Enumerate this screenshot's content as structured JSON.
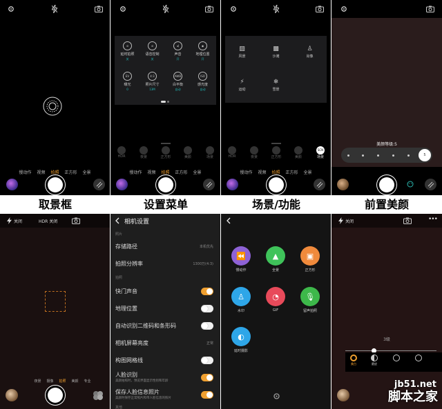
{
  "captions": [
    "取景框",
    "设置菜单",
    "场景/功能",
    "前置美颜"
  ],
  "camera_modes": [
    "慢动作",
    "视频",
    "拍照",
    "正方形",
    "全景"
  ],
  "active_mode": "拍照",
  "panel2": {
    "menu": [
      {
        "label": "延时拍照",
        "value": "关",
        "icon": "timer-off-icon"
      },
      {
        "label": "语音控制",
        "value": "关",
        "icon": "mic-off-icon"
      },
      {
        "label": "声音",
        "value": "开",
        "icon": "sound-icon"
      },
      {
        "label": "地理位置",
        "value": "开",
        "icon": "location-icon"
      },
      {
        "label": "曝光",
        "value": "0",
        "icon": "ev-icon",
        "glyph": "EV"
      },
      {
        "label": "照片尺寸",
        "value": "13M",
        "icon": "ratio-icon",
        "glyph": "4:3"
      },
      {
        "label": "白平衡",
        "value": "自动",
        "icon": "awb-icon",
        "glyph": "AWB"
      },
      {
        "label": "感光度",
        "value": "自动",
        "icon": "iso-icon",
        "glyph": "ISO"
      }
    ],
    "tools": [
      "HDR",
      "夜景",
      "正方形",
      "美颜",
      "场景"
    ]
  },
  "panel3": {
    "scenes": [
      {
        "label": "风景",
        "icon": "landscape-icon"
      },
      {
        "label": "沙滩",
        "icon": "beach-icon"
      },
      {
        "label": "肖像",
        "icon": "portrait-icon"
      },
      {
        "label": "运动",
        "icon": "sport-icon"
      },
      {
        "label": "雪景",
        "icon": "snow-icon"
      }
    ],
    "tools": [
      "HDR",
      "夜景",
      "正方形",
      "美颜",
      "场景"
    ],
    "scene_badge": "SCN"
  },
  "panel4": {
    "beauty_label": "美颜等级:5",
    "beauty_value": "5",
    "beauty_level": 5,
    "beauty_max": 6
  },
  "panel5": {
    "flash_label": "关闭",
    "hdr_label": "HDR 关闭",
    "modes": [
      "夜景",
      "摄像",
      "拍照",
      "美颜",
      "专业"
    ],
    "active_mode": "拍照"
  },
  "panel6": {
    "title": "相机设置",
    "section_photo": "照片",
    "section_shoot": "拍照",
    "section_other": "其他",
    "rows": [
      {
        "label": "存储路径",
        "right": "本机优先"
      },
      {
        "label": "拍照分辨率",
        "right": "1300万(4:3)"
      },
      {
        "label": "快门声音",
        "toggle": true
      },
      {
        "label": "地理位置",
        "toggle": false
      },
      {
        "label": "自动识别二维码和条形码",
        "toggle": false
      },
      {
        "label": "相机屏幕亮度",
        "right": "正常"
      },
      {
        "label": "构图网格线",
        "toggle": false
      },
      {
        "label": "人脸识别",
        "sub": "美颜拍照时，预览界面显示性别和年龄",
        "toggle": true
      },
      {
        "label": "保存人脸信息照片",
        "sub": "美颜时保存正常照片和带人脸信息的照片",
        "toggle": true
      }
    ]
  },
  "panel7": {
    "features": [
      {
        "label": "慢动作",
        "color": "#8e62d6",
        "icon": "slowmo-icon"
      },
      {
        "label": "全景",
        "color": "#3fc35a",
        "icon": "panorama-icon"
      },
      {
        "label": "正方形",
        "color": "#f08a3c",
        "icon": "square-icon"
      },
      {
        "label": "水印",
        "color": "#2ea6e8",
        "icon": "watermark-stamp-icon"
      },
      {
        "label": "GIF",
        "color": "#e84a5a",
        "icon": "gif-icon"
      },
      {
        "label": "留声拍照",
        "color": "#3db84a",
        "icon": "voice-photo-icon"
      },
      {
        "label": "延时摄影",
        "color": "#2ea6e8",
        "icon": "timelapse-icon"
      }
    ]
  },
  "panel8": {
    "flash_label": "关闭",
    "level_label": "3级",
    "level": 3,
    "tools": [
      {
        "label": "美白",
        "icon": "whiten-icon"
      },
      {
        "label": "磨皮",
        "icon": "smooth-icon"
      },
      {
        "label": "",
        "icon": "face-icon"
      },
      {
        "label": "",
        "icon": "eye-icon"
      }
    ]
  },
  "watermark": {
    "site": "jb51.net",
    "name": "脚本之家"
  },
  "colors": {
    "accent": "#f0a030",
    "teal": "#2bb8b0",
    "background": "#000000"
  }
}
